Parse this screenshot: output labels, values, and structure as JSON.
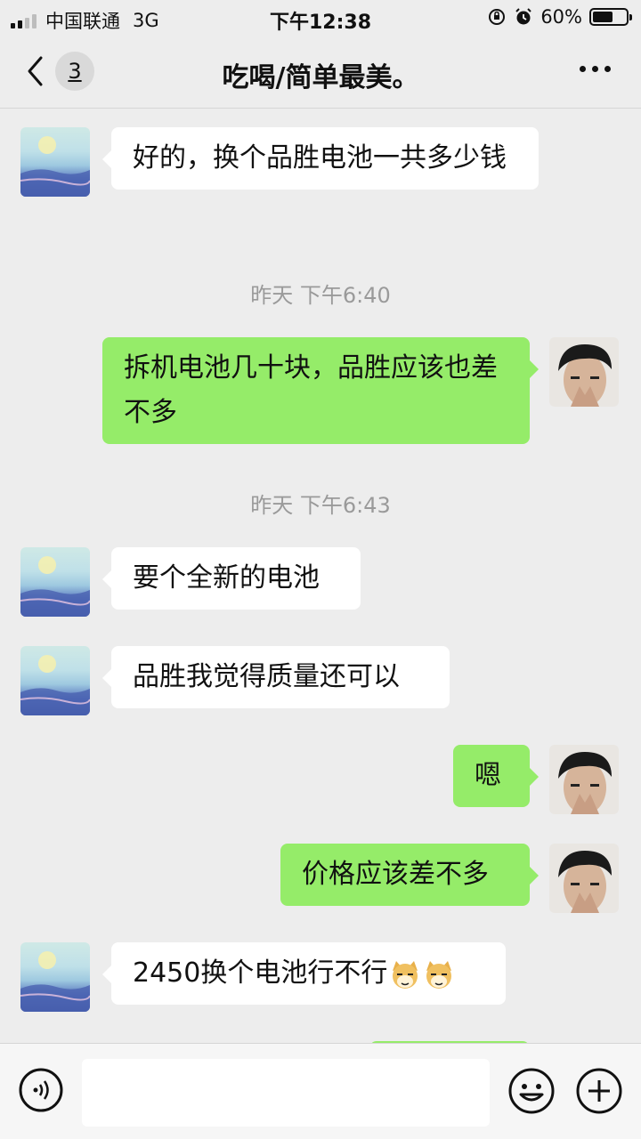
{
  "status_bar": {
    "carrier": "中国联通",
    "network": "3G",
    "time": "下午12:38",
    "battery_text": "60%",
    "battery_level": 0.6,
    "icons": [
      "signal-icon",
      "orientation-lock-icon",
      "alarm-icon",
      "battery-icon"
    ]
  },
  "nav": {
    "back_icon": "chevron-left-icon",
    "unread_count": "3",
    "title": "吃喝/简单最美。",
    "more_icon": "more-dots-icon"
  },
  "messages": [
    {
      "sender": "other",
      "text": "好的，换个品胜电池一共多少钱"
    },
    {
      "timestamp": "昨天 下午6:40"
    },
    {
      "sender": "self",
      "text": "拆机电池几十块，品胜应该也差不多"
    },
    {
      "timestamp": "昨天 下午6:43"
    },
    {
      "sender": "other",
      "text": "要个全新的电池"
    },
    {
      "sender": "other",
      "text": "品胜我觉得质量还可以"
    },
    {
      "sender": "self",
      "text": "嗯"
    },
    {
      "sender": "self",
      "text": "价格应该差不多"
    },
    {
      "sender": "other",
      "text": "2450换个电池行不行",
      "emoji": [
        "doge-emoji",
        "doge-emoji"
      ]
    }
  ],
  "input_bar": {
    "voice_icon": "voice-icon",
    "text_value": "",
    "emoji_icon": "emoji-icon",
    "plus_icon": "plus-icon"
  },
  "colors": {
    "background": "#ededed",
    "self_bubble": "#95ec69",
    "other_bubble": "#ffffff",
    "timestamp_text": "#9a9a9a"
  }
}
